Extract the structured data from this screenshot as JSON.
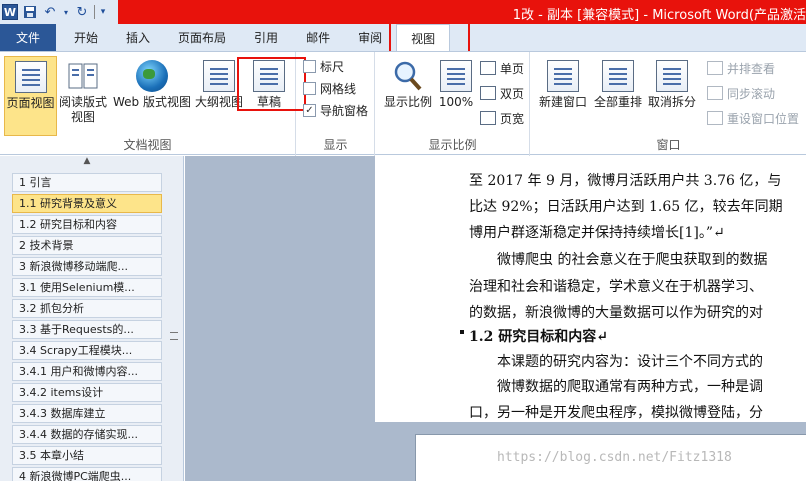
{
  "window": {
    "title": "1改 - 副本 [兼容模式] - Microsoft Word(产品激活"
  },
  "qat": {
    "word_logo": "W",
    "save_icon": "save-icon",
    "undo_icon": "undo-icon",
    "redo_icon": "redo-icon"
  },
  "tabs": [
    {
      "label": "文件"
    },
    {
      "label": "开始"
    },
    {
      "label": "插入"
    },
    {
      "label": "页面布局"
    },
    {
      "label": "引用"
    },
    {
      "label": "邮件"
    },
    {
      "label": "审阅"
    },
    {
      "label": "视图",
      "active": true
    }
  ],
  "ribbon": {
    "doc_view": {
      "label": "文档视图",
      "buttons": [
        "页面视图",
        "阅读版式视图",
        "Web 版式视图",
        "大纲视图",
        "草稿"
      ]
    },
    "show": {
      "label": "显示",
      "items": [
        {
          "label": "标尺",
          "checked": false
        },
        {
          "label": "网格线",
          "checked": false
        },
        {
          "label": "导航窗格",
          "checked": true
        }
      ]
    },
    "zoom": {
      "label": "显示比例",
      "zoom_button": "显示比例",
      "pct_button": "100%",
      "single": "单页",
      "double": "双页",
      "width": "页宽"
    },
    "window": {
      "label": "窗口",
      "new_window": "新建窗口",
      "arrange_all": "全部重排",
      "split": "取消拆分",
      "side_by_side": "并排查看",
      "sync_scroll": "同步滚动",
      "reset_pos": "重设窗口位置"
    }
  },
  "nav": {
    "items": [
      {
        "label": "1  引言"
      },
      {
        "label": "1.1  研究背景及意义",
        "selected": true
      },
      {
        "label": "1.2  研究目标和内容"
      },
      {
        "label": "2  技术背景"
      },
      {
        "label": "3  新浪微博移动端爬..."
      },
      {
        "label": "3.1  使用Selenium模..."
      },
      {
        "label": "3.2  抓包分析"
      },
      {
        "label": "3.3  基于Requests的..."
      },
      {
        "label": "3.4  Scrapy工程模块..."
      },
      {
        "label": "3.4.1  用户和微博内容..."
      },
      {
        "label": "3.4.2  items设计"
      },
      {
        "label": "3.4.3  数据库建立"
      },
      {
        "label": "3.4.4  数据的存储实现..."
      },
      {
        "label": "3.5  本章小结"
      },
      {
        "label": "4  新浪微博PC端爬虫..."
      }
    ]
  },
  "document": {
    "lines": [
      "至 2017 年 9 月，微博月活跃用户共 3.76 亿，与",
      "比达 92%；日活跃用户达到 1.65 亿，较去年同期",
      "博用户群逐渐稳定并保持持续增长[1]。”↵",
      "　　微博爬虫 的社会意义在于爬虫获取到的数据",
      "治理和社会和谐稳定，学术意义在于机器学习、",
      "的数据，新浪微博的大量数据可以作为研究的对",
      "1.2   研究目标和内容↵",
      "　　本课题的研究内容为：设计三个不同方式的",
      "　　微博数据的爬取通常有两种方式，一种是调",
      "口，另一种是开发爬虫程序，模拟微博登陆，分"
    ],
    "watermark": "https://blog.csdn.net/Fitz1318"
  }
}
